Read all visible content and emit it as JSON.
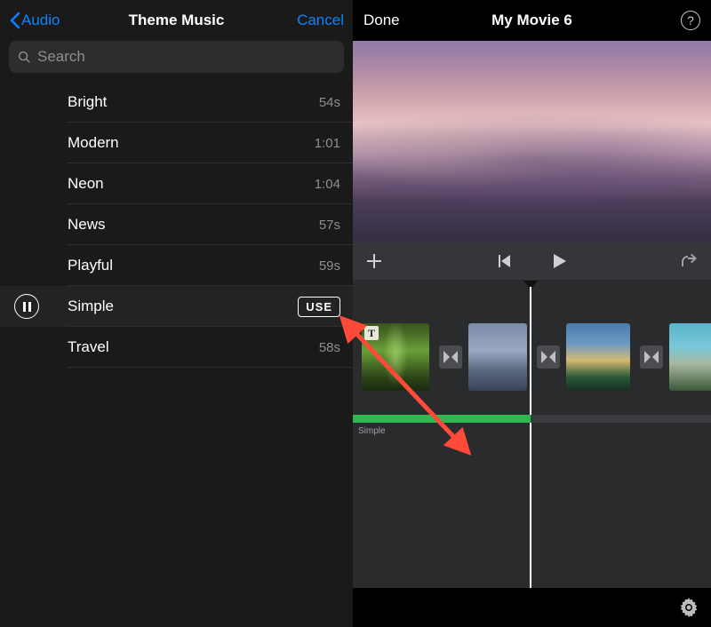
{
  "left": {
    "back": "Audio",
    "title": "Theme Music",
    "cancel": "Cancel",
    "searchPlaceholder": "Search",
    "tracks": [
      {
        "name": "Bright",
        "dur": "54s",
        "selected": false
      },
      {
        "name": "Modern",
        "dur": "1:01",
        "selected": false
      },
      {
        "name": "Neon",
        "dur": "1:04",
        "selected": false
      },
      {
        "name": "News",
        "dur": "57s",
        "selected": false
      },
      {
        "name": "Playful",
        "dur": "59s",
        "selected": false
      },
      {
        "name": "Simple",
        "dur": "",
        "selected": true
      },
      {
        "name": "Travel",
        "dur": "58s",
        "selected": false
      }
    ],
    "useLabel": "USE"
  },
  "right": {
    "done": "Done",
    "title": "My Movie 6",
    "audioTrackLabel": "Simple"
  },
  "titleBadge": "T"
}
